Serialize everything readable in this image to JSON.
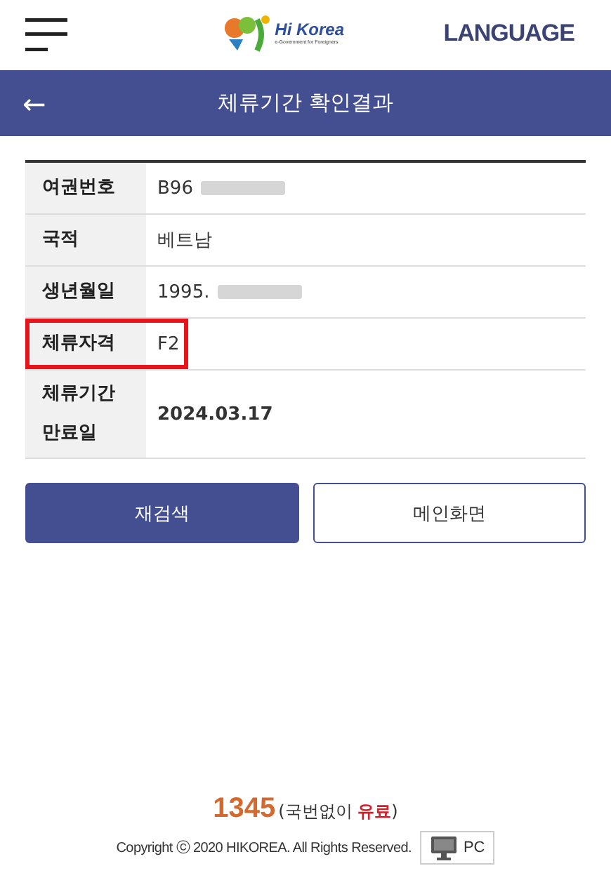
{
  "header": {
    "logo_text": "Hi Korea",
    "logo_subtitle": "e-Government for Foreigners",
    "language": "LANGUAGE"
  },
  "title_bar": {
    "back": "←",
    "title": "체류기간 확인결과"
  },
  "rows": [
    {
      "label": "여권번호",
      "value": "B96",
      "redacted": true,
      "highlighted": false,
      "bold": false
    },
    {
      "label": "국적",
      "value": "베트남",
      "redacted": false,
      "highlighted": false,
      "bold": false
    },
    {
      "label": "생년월일",
      "value": "1995.",
      "redacted": true,
      "highlighted": false,
      "bold": false
    },
    {
      "label": "체류자격",
      "value": "F2",
      "redacted": false,
      "highlighted": true,
      "bold": false
    },
    {
      "label": "체류기간\n만료일",
      "value": "2024.03.17",
      "redacted": false,
      "highlighted": false,
      "bold": true
    }
  ],
  "buttons": [
    {
      "label": "재검색",
      "kind": "primary"
    },
    {
      "label": "메인화면",
      "kind": "outline"
    }
  ],
  "footer": {
    "phone": "1345",
    "phone_note": "(국번없이 **유료**)",
    "copyright": "Copyright ⓒ 2020 HIKOREA. All Rights Reserved.",
    "pc": "PC"
  }
}
